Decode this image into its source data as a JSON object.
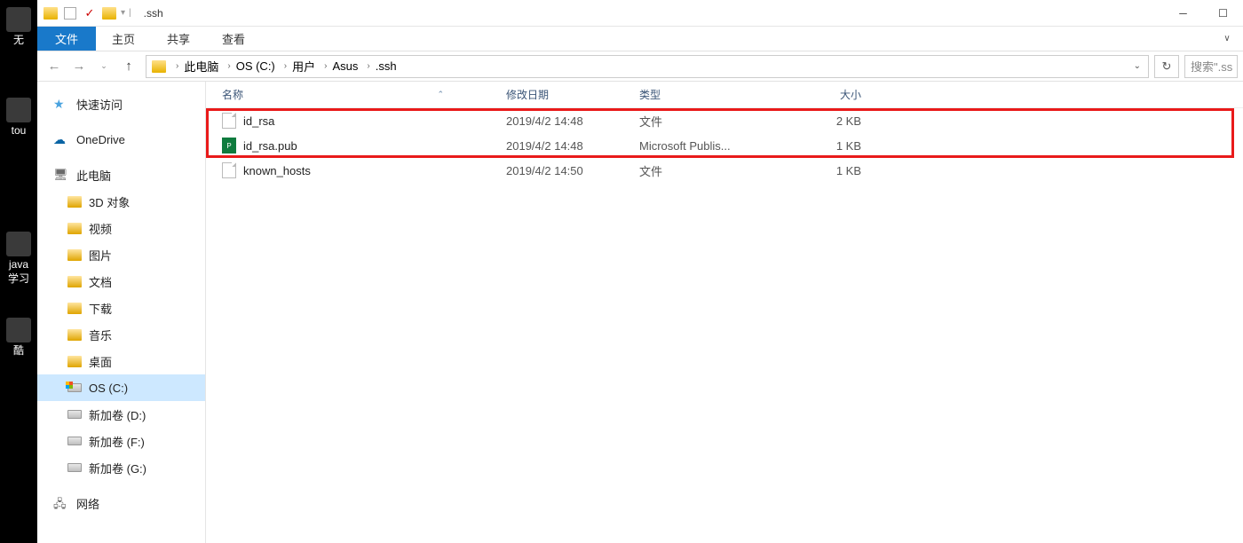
{
  "desktop": {
    "items": [
      {
        "label": "无"
      },
      {
        "label": "tou"
      },
      {
        "label": "java\n学习"
      },
      {
        "label": "酷"
      }
    ]
  },
  "titlebar": {
    "title": ".ssh"
  },
  "ribbon": {
    "file": "文件",
    "tabs": [
      "主页",
      "共享",
      "查看"
    ]
  },
  "breadcrumb": {
    "items": [
      "此电脑",
      "OS (C:)",
      "用户",
      "Asus",
      ".ssh"
    ]
  },
  "search": {
    "placeholder": "搜索\".ss"
  },
  "sidebar": {
    "quick": "快速访问",
    "onedrive": "OneDrive",
    "thispc": "此电脑",
    "folders": [
      "3D 对象",
      "视频",
      "图片",
      "文档",
      "下载",
      "音乐",
      "桌面"
    ],
    "drives": [
      {
        "label": "OS (C:)",
        "os": true,
        "selected": true
      },
      {
        "label": "新加卷 (D:)"
      },
      {
        "label": "新加卷 (F:)"
      },
      {
        "label": "新加卷 (G:)"
      }
    ],
    "network": "网络"
  },
  "columns": {
    "name": "名称",
    "date": "修改日期",
    "type": "类型",
    "size": "大小"
  },
  "files": [
    {
      "name": "id_rsa",
      "date": "2019/4/2 14:48",
      "type": "文件",
      "size": "2 KB",
      "icon": "file"
    },
    {
      "name": "id_rsa.pub",
      "date": "2019/4/2 14:48",
      "type": "Microsoft Publis...",
      "size": "1 KB",
      "icon": "pub"
    },
    {
      "name": "known_hosts",
      "date": "2019/4/2 14:50",
      "type": "文件",
      "size": "1 KB",
      "icon": "file"
    }
  ]
}
